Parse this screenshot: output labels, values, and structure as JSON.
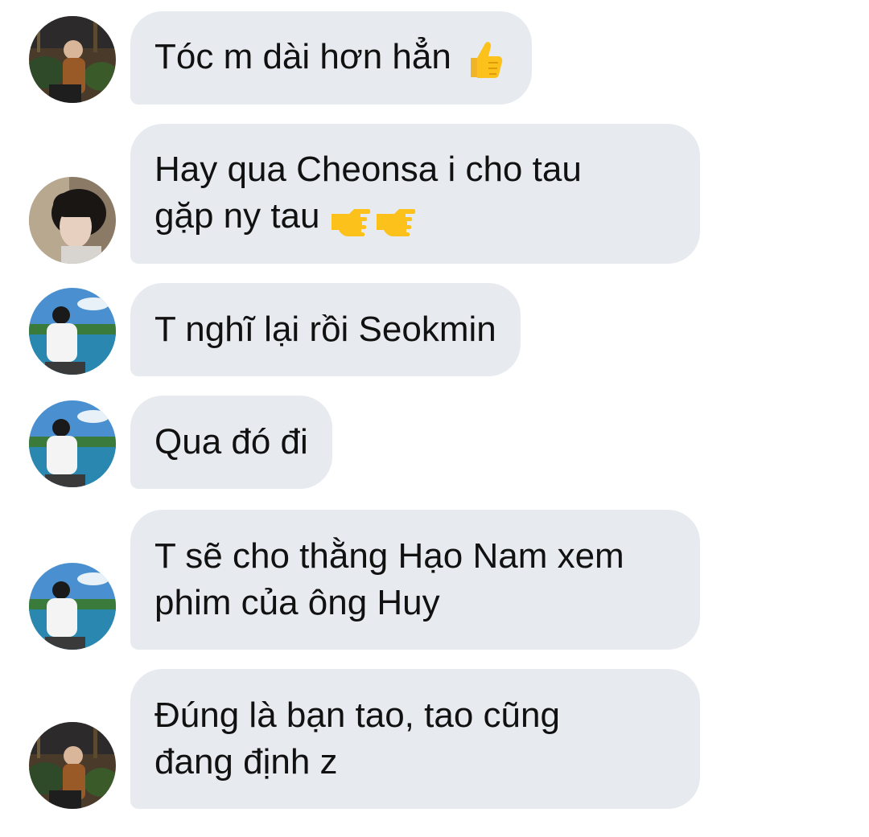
{
  "messages": [
    {
      "lines": [
        "Tóc m dài hơn hẳn"
      ],
      "emoji": "thumbs-up-icon",
      "avatar": "avatar-autumn-park"
    },
    {
      "lines": [
        "Hay qua Cheonsa i cho tau",
        "gặp ny tau"
      ],
      "emoji": "pointing-hands-icon",
      "avatar": "avatar-dark-hair-profile"
    },
    {
      "lines": [
        "T nghĩ lại rồi Seokmin"
      ],
      "avatar": "avatar-seaside"
    },
    {
      "lines": [
        "Qua đó đi"
      ],
      "avatar": "avatar-seaside"
    },
    {
      "lines": [
        "T sẽ cho thằng Hạo Nam xem",
        "phim của ông Huy"
      ],
      "avatar": "avatar-seaside"
    },
    {
      "lines": [
        "Đúng là bạn tao, tao cũng",
        "đang định z"
      ],
      "avatar": "avatar-autumn-park"
    }
  ],
  "colors": {
    "bubble_bg": "#e7ebf0",
    "text": "#111111",
    "background": "#ffffff"
  }
}
